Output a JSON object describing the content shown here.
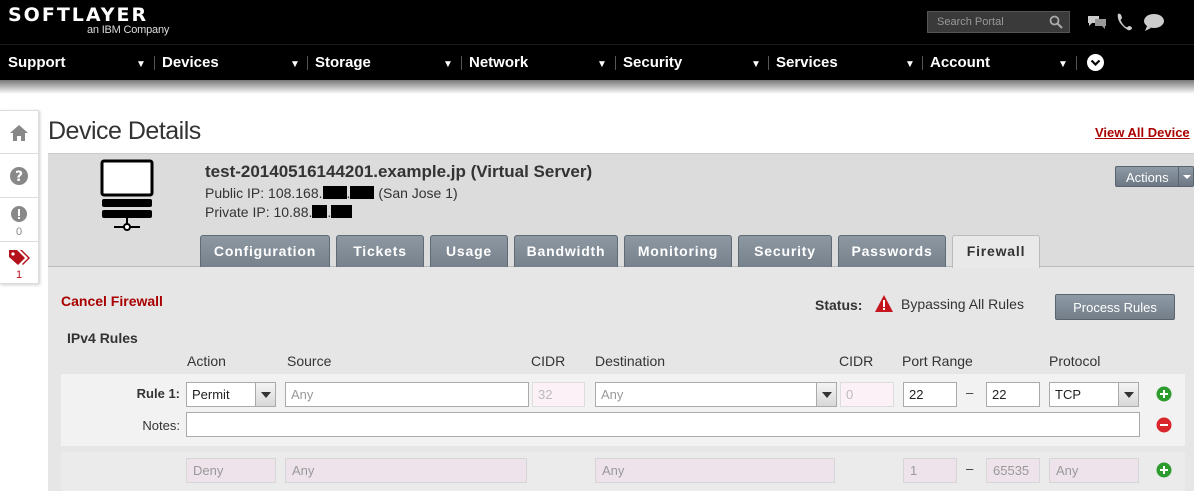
{
  "brand": {
    "logo": "SOFTLAYER",
    "sub": "an IBM Company"
  },
  "search": {
    "placeholder": "Search Portal"
  },
  "nav": [
    "Support",
    "Devices",
    "Storage",
    "Network",
    "Security",
    "Services",
    "Account"
  ],
  "rail": {
    "alerts_count": "0",
    "tags_count": "1"
  },
  "page": {
    "title": "Device Details",
    "view_all": "View All Device"
  },
  "device": {
    "name": "test-20140516144201.example.jp (Virtual Server)",
    "public_ip_label": "Public IP: 108.168.",
    "public_ip_suffix": "(San Jose 1)",
    "private_ip_label": "Private IP: 10.88.",
    "actions_label": "Actions"
  },
  "tabs": [
    "Configuration",
    "Tickets",
    "Usage",
    "Bandwidth",
    "Monitoring",
    "Security",
    "Passwords",
    "Firewall"
  ],
  "active_tab": "Firewall",
  "firewall": {
    "cancel_label": "Cancel Firewall",
    "status_label": "Status:",
    "status_text": "Bypassing All Rules",
    "process_label": "Process Rules",
    "section_title": "IPv4 Rules",
    "columns": [
      "Action",
      "Source",
      "CIDR",
      "Destination",
      "CIDR",
      "Port Range",
      "Protocol"
    ],
    "rule1": {
      "label": "Rule 1:",
      "action": "Permit",
      "source_placeholder": "Any",
      "source_cidr": "32",
      "destination": "Any",
      "destination_cidr": "0",
      "port_from": "22",
      "port_to": "22",
      "protocol": "TCP",
      "notes_label": "Notes:",
      "dash": "–"
    },
    "default_rule": {
      "action": "Deny",
      "source": "Any",
      "destination": "Any",
      "port_from": "1",
      "port_to": "65535",
      "protocol": "Any",
      "dash": "–"
    }
  },
  "colors": {
    "accent_red": "#aa0000",
    "button_gray": "#7b8691",
    "add_green": "#2e9b2e",
    "remove_red": "#d9262a"
  }
}
